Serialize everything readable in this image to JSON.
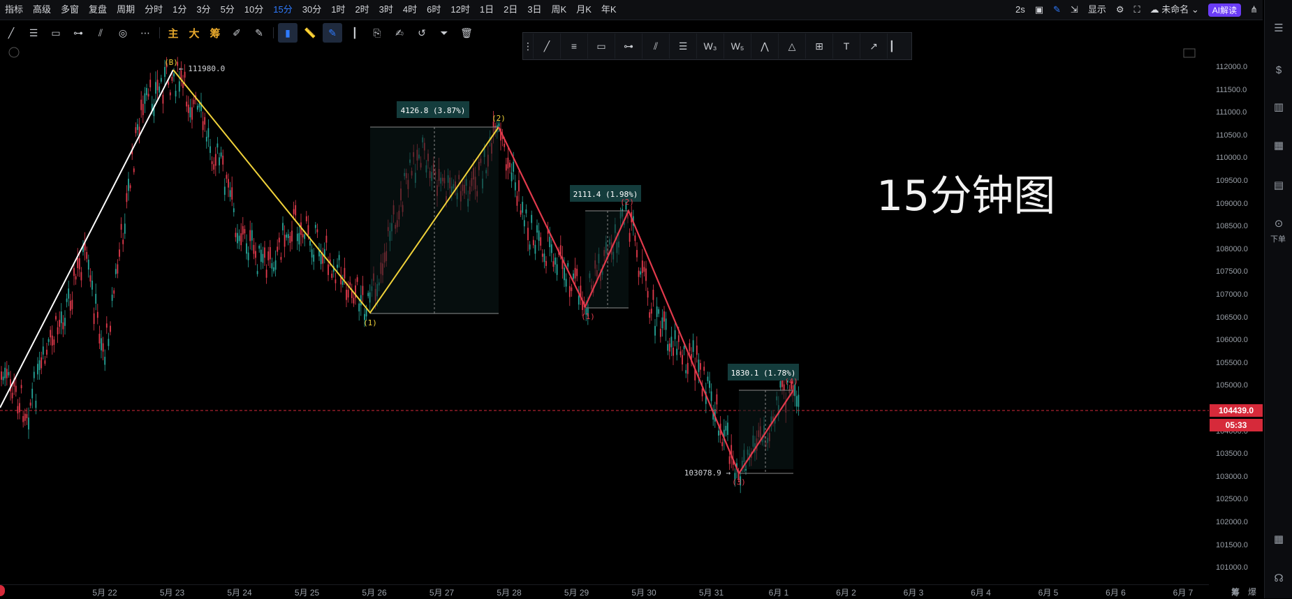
{
  "topbar": {
    "items": [
      "指标",
      "高级",
      "多窗",
      "复盘",
      "周期",
      "分时",
      "1分",
      "3分",
      "5分",
      "10分",
      "15分",
      "30分",
      "1时",
      "2时",
      "3时",
      "4时",
      "6时",
      "12时",
      "1日",
      "2日",
      "3日",
      "周K",
      "月K",
      "年K"
    ],
    "active": "15分",
    "refresh": "2s",
    "display_label": "显示",
    "layout_name": "未命名",
    "ai_label": "AI解读"
  },
  "toolbar2": {
    "text_tools": [
      "主",
      "大",
      "筹"
    ]
  },
  "chart": {
    "title": "15分钟图",
    "current_price": "104439.0",
    "countdown": "05:33",
    "price_ticks": [
      "112000.0",
      "111500.0",
      "111000.0",
      "110500.0",
      "110000.0",
      "109500.0",
      "109000.0",
      "108500.0",
      "108000.0",
      "107500.0",
      "107000.0",
      "106500.0",
      "106000.0",
      "105500.0",
      "105000.0",
      "104500.0",
      "104000.0",
      "103500.0",
      "103000.0",
      "102500.0",
      "102000.0",
      "101500.0",
      "101000.0"
    ],
    "date_ticks": [
      "5月 22",
      "5月 23",
      "5月 24",
      "5月 25",
      "5月 26",
      "5月 27",
      "5月 28",
      "5月 29",
      "5月 30",
      "5月 31",
      "6月 1",
      "6月 2",
      "6月 3",
      "6月 4",
      "6月 5",
      "6月 6",
      "6月 7"
    ],
    "annotations": {
      "high_label": "111980.0",
      "low_label": "103078.9",
      "measure1": "4126.8 (3.87%)",
      "measure2": "2111.4 (1.98%)",
      "measure3": "1830.1 (1.78%)",
      "wave_B": "(B)",
      "wave_y1": "(1)",
      "wave_y2": "(2)",
      "wave_r1": "(1)",
      "wave_r2": "(2)",
      "wave_r3": "(3)",
      "wave_r4": "(4)"
    }
  },
  "rightpanel": {
    "order_label": "下单"
  },
  "footer": {
    "left_glyph": "筹",
    "right_glyph": "爆"
  }
}
